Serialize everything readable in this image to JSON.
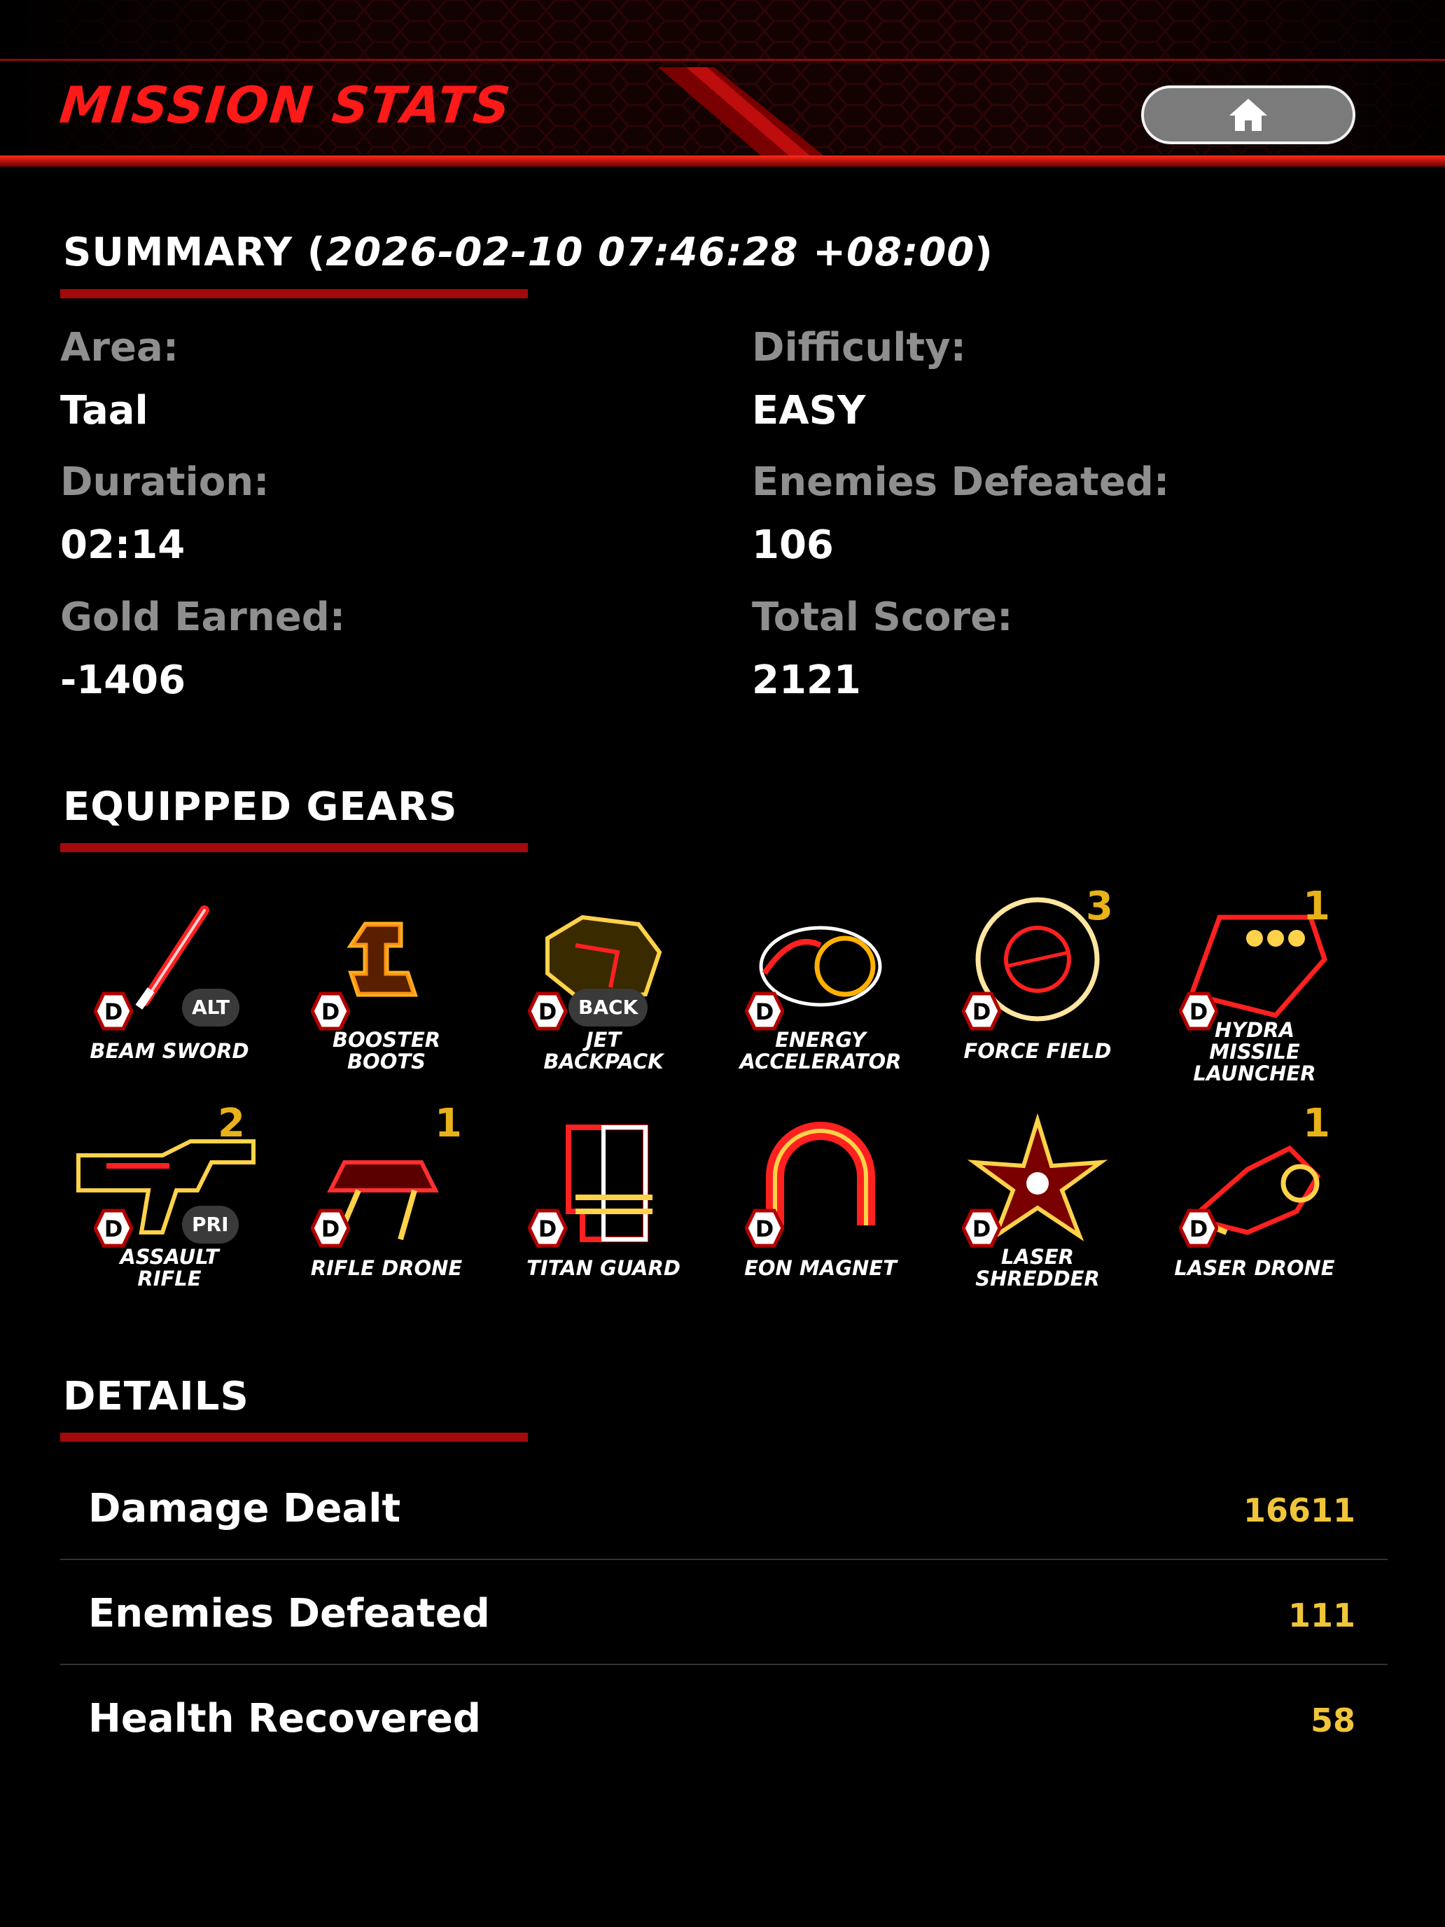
{
  "header": {
    "title": "MISSION STATS",
    "home_icon": "home-icon"
  },
  "summary": {
    "heading": "SUMMARY (",
    "timestamp": "2026-02-10 07:46:28 +08:00",
    "heading_close": ")",
    "area_label": "Area:",
    "area_value": "Taal",
    "difficulty_label": "Difficulty:",
    "difficulty_value": "EASY",
    "duration_label": "Duration:",
    "duration_value": "02:14",
    "enemies_label": "Enemies Defeated:",
    "enemies_value": "106",
    "gold_label": "Gold Earned:",
    "gold_value": "-1406",
    "score_label": "Total Score:",
    "score_value": "2121"
  },
  "gears": {
    "heading": "EQUIPPED GEARS",
    "items": [
      {
        "name": "BEAM SWORD",
        "badge": "D",
        "tag": "ALT",
        "count": "",
        "icon": "beam-sword-icon"
      },
      {
        "name": "BOOSTER\nBOOTS",
        "badge": "D",
        "tag": "",
        "count": "",
        "icon": "booster-boots-icon"
      },
      {
        "name": "JET\nBACKPACK",
        "badge": "D",
        "tag": "BACK",
        "count": "",
        "icon": "jet-backpack-icon"
      },
      {
        "name": "ENERGY\nACCELERATOR",
        "badge": "D",
        "tag": "",
        "count": "",
        "icon": "energy-accelerator-icon"
      },
      {
        "name": "FORCE FIELD",
        "badge": "D",
        "tag": "",
        "count": "3",
        "icon": "force-field-icon"
      },
      {
        "name": "HYDRA\nMISSILE\nLAUNCHER",
        "badge": "D",
        "tag": "",
        "count": "1",
        "icon": "hydra-missile-launcher-icon"
      },
      {
        "name": "ASSAULT\nRIFLE",
        "badge": "D",
        "tag": "PRI",
        "count": "2",
        "icon": "assault-rifle-icon"
      },
      {
        "name": "RIFLE DRONE",
        "badge": "D",
        "tag": "",
        "count": "1",
        "icon": "rifle-drone-icon"
      },
      {
        "name": "TITAN GUARD",
        "badge": "D",
        "tag": "",
        "count": "",
        "icon": "titan-guard-icon"
      },
      {
        "name": "EON MAGNET",
        "badge": "D",
        "tag": "",
        "count": "",
        "icon": "eon-magnet-icon"
      },
      {
        "name": "LASER\nSHREDDER",
        "badge": "D",
        "tag": "",
        "count": "",
        "icon": "laser-shredder-icon"
      },
      {
        "name": "LASER DRONE",
        "badge": "D",
        "tag": "",
        "count": "1",
        "icon": "laser-drone-icon"
      }
    ]
  },
  "details": {
    "heading": "DETAILS",
    "rows": [
      {
        "label": "Damage Dealt",
        "value": "16611"
      },
      {
        "label": "Enemies Defeated",
        "value": "111"
      },
      {
        "label": "Health Recovered",
        "value": "58"
      }
    ]
  },
  "colors": {
    "accent_red": "#ff1a1a",
    "underline_red": "#a4090b",
    "value_gold": "#f0c53a",
    "label_gray": "#8f8f8f"
  }
}
